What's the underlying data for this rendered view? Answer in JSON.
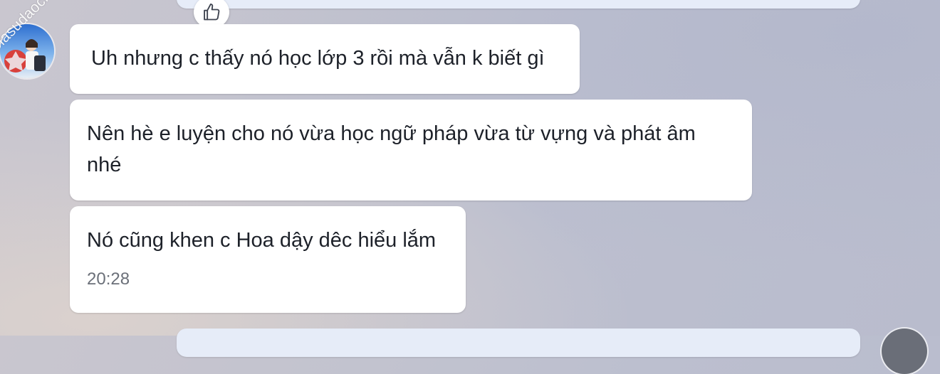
{
  "watermark": "Giasudaochat.net",
  "messages": [
    {
      "text": "Uh nhưng c thấy nó học lớp 3 rồi mà vẫn k biết gì"
    },
    {
      "text": "Nên hè e luyện cho nó vừa học ngữ pháp vừa từ vựng và phát âm nhé"
    },
    {
      "text": "Nó cũng khen c Hoa dậy dêc hiểu lắm",
      "time": "20:28"
    }
  ],
  "reaction": {
    "icon": "thumbs-up-icon"
  },
  "colors": {
    "bubble_bg": "#ffffff",
    "sent_bubble_bg": "#e6ecf8",
    "text": "#1d2129",
    "time_text": "#6b7079"
  }
}
